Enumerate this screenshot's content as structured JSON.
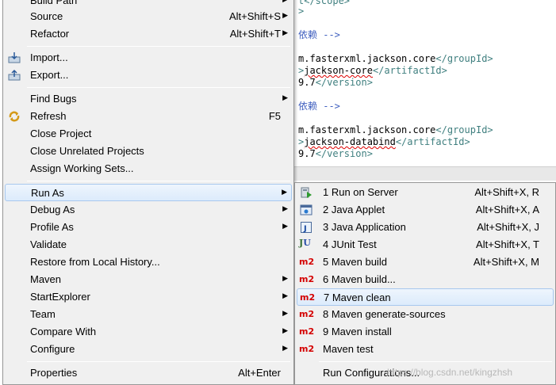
{
  "editor": {
    "lines": [
      {
        "t1": "",
        "tag": "t</scope>",
        "t2": ""
      },
      {
        "t1": "",
        "tag": ">",
        "t2": ""
      },
      {
        "comment": "依赖 -->"
      },
      {
        "text": "m.fasterxml.jackson.core",
        "tag": "</groupId>"
      },
      {
        "tagA": ">",
        "text": "jackson-core",
        "tag": "</artifactId>"
      },
      {
        "text": "9.7",
        "tag": "</version>"
      },
      {
        "comment": "依赖 -->"
      },
      {
        "text": "m.fasterxml.jackson.core",
        "tag": "</groupId>"
      },
      {
        "tagA": ">",
        "text": "jackson-databind",
        "tag": "</artifactId>"
      },
      {
        "text": "9.7",
        "tag": "</version>"
      }
    ]
  },
  "main_menu": {
    "items": [
      {
        "label": "Build Path",
        "arrow": "▶"
      },
      {
        "label": "Source",
        "shortcut": "Alt+Shift+S",
        "arrow": "▶"
      },
      {
        "label": "Refactor",
        "shortcut": "Alt+Shift+T",
        "arrow": "▶"
      },
      {
        "label": "Import..."
      },
      {
        "label": "Export..."
      },
      {
        "label": "Find Bugs",
        "arrow": "▶"
      },
      {
        "label": "Refresh",
        "shortcut": "F5"
      },
      {
        "label": "Close Project"
      },
      {
        "label": "Close Unrelated Projects"
      },
      {
        "label": "Assign Working Sets..."
      },
      {
        "label": "Run As",
        "arrow": "▶"
      },
      {
        "label": "Debug As",
        "arrow": "▶"
      },
      {
        "label": "Profile As",
        "arrow": "▶"
      },
      {
        "label": "Validate"
      },
      {
        "label": "Restore from Local History..."
      },
      {
        "label": "Maven",
        "arrow": "▶"
      },
      {
        "label": "StartExplorer",
        "arrow": "▶"
      },
      {
        "label": "Team",
        "arrow": "▶"
      },
      {
        "label": "Compare With",
        "arrow": "▶"
      },
      {
        "label": "Configure",
        "arrow": "▶"
      },
      {
        "label": "Properties",
        "shortcut": "Alt+Enter"
      }
    ]
  },
  "sub_menu": {
    "items": [
      {
        "label": "1 Run on Server",
        "shortcut": "Alt+Shift+X, R"
      },
      {
        "label": "2 Java Applet",
        "shortcut": "Alt+Shift+X, A"
      },
      {
        "label": "3 Java Application",
        "shortcut": "Alt+Shift+X, J"
      },
      {
        "label": "4 JUnit Test",
        "shortcut": "Alt+Shift+X, T"
      },
      {
        "label": "5 Maven build",
        "shortcut": "Alt+Shift+X, M"
      },
      {
        "label": "6 Maven build..."
      },
      {
        "label": "7 Maven clean"
      },
      {
        "label": "8 Maven generate-sources"
      },
      {
        "label": "9 Maven install"
      },
      {
        "label": "Maven test"
      },
      {
        "label": "Run Configurations..."
      }
    ],
    "m2_label": "m2",
    "junit_label": "J",
    "junit_label2": "U"
  },
  "watermark": "https://blog.csdn.net/kingzhsh",
  "colors": {
    "highlight": "#dcebfc",
    "m2": "#d40000",
    "xml_tag": "#3f7f7f",
    "xml_comment": "#3f5fbf"
  }
}
